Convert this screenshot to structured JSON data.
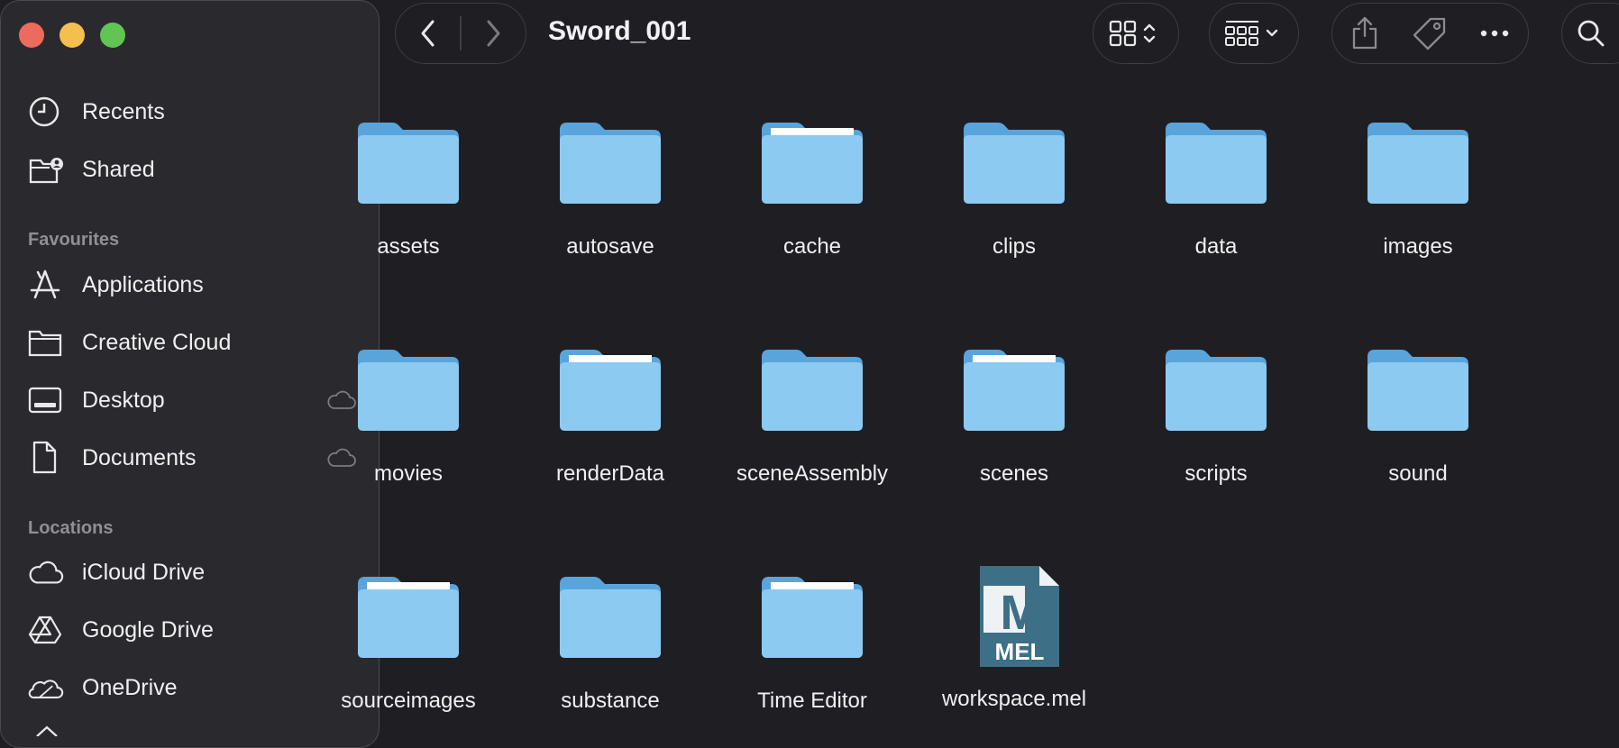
{
  "window": {
    "title": "Sword_001",
    "traffic_lights": {
      "close": "#ed6a5e",
      "minimize": "#f5bf4f",
      "zoom": "#61c554"
    }
  },
  "sidebar": {
    "top_items": [
      {
        "label": "Recents",
        "icon": "clock-icon"
      },
      {
        "label": "Shared",
        "icon": "shared-folder-icon"
      }
    ],
    "favourites_title": "Favourites",
    "favourites": [
      {
        "label": "Applications",
        "icon": "applications-icon"
      },
      {
        "label": "Creative Cloud",
        "icon": "folder-icon"
      },
      {
        "label": "Desktop",
        "icon": "desktop-icon",
        "cloud": true
      },
      {
        "label": "Documents",
        "icon": "document-icon",
        "cloud": true
      }
    ],
    "locations_title": "Locations",
    "locations": [
      {
        "label": "iCloud Drive",
        "icon": "cloud-icon"
      },
      {
        "label": "Google Drive",
        "icon": "google-drive-icon"
      },
      {
        "label": "OneDrive",
        "icon": "onedrive-icon"
      }
    ]
  },
  "toolbar": {
    "back": "chevron-left-icon",
    "forward": "chevron-right-icon",
    "view_toggle": "grid-view-icon",
    "group": "group-view-icon",
    "share": "share-icon",
    "tag": "tag-icon",
    "more": "more-icon",
    "search": "search-icon"
  },
  "files": [
    {
      "name": "assets",
      "type": "folder",
      "docs": false
    },
    {
      "name": "autosave",
      "type": "folder",
      "docs": false
    },
    {
      "name": "cache",
      "type": "folder",
      "docs": true
    },
    {
      "name": "clips",
      "type": "folder",
      "docs": false
    },
    {
      "name": "data",
      "type": "folder",
      "docs": false
    },
    {
      "name": "images",
      "type": "folder",
      "docs": false
    },
    {
      "name": "movies",
      "type": "folder",
      "docs": false
    },
    {
      "name": "renderData",
      "type": "folder",
      "docs": true
    },
    {
      "name": "sceneAssembly",
      "type": "folder",
      "docs": false
    },
    {
      "name": "scenes",
      "type": "folder",
      "docs": true
    },
    {
      "name": "scripts",
      "type": "folder",
      "docs": false
    },
    {
      "name": "sound",
      "type": "folder",
      "docs": false
    },
    {
      "name": "sourceimages",
      "type": "folder",
      "docs": true
    },
    {
      "name": "substance",
      "type": "folder",
      "docs": false
    },
    {
      "name": "Time Editor",
      "type": "folder",
      "docs": true
    },
    {
      "name": "workspace.mel",
      "type": "mel",
      "badge_letter": "M",
      "badge_text": "MEL"
    }
  ],
  "colors": {
    "folder_back": "#5aa4dc",
    "folder_front": "#8ccaf2",
    "mel_file": "#3d6f87"
  }
}
